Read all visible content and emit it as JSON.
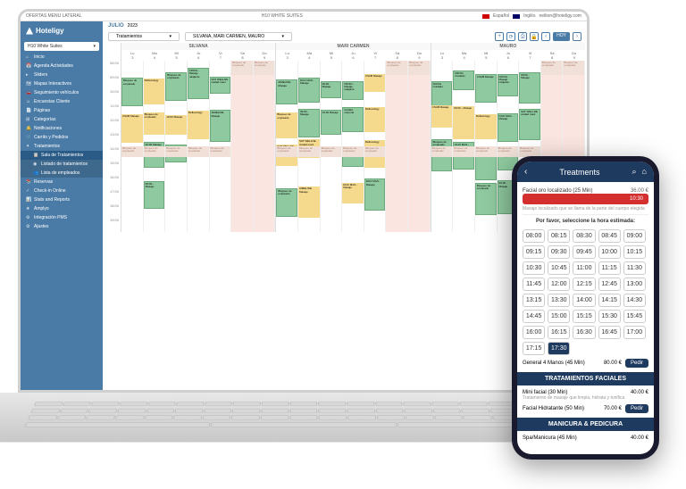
{
  "brand": "Hoteligy",
  "topbar": {
    "breadcrumb": "OFERTAS MENU LATERAL",
    "hotel_name": "H10 WHITE SUITES",
    "lang1": "Español",
    "lang2": "Inglés",
    "email": "neliton@hoteligy.com"
  },
  "sidebar": {
    "hotel": "H10 White Suites",
    "items": [
      {
        "icon": "⌂",
        "label": "Inicio"
      },
      {
        "icon": "📅",
        "label": "Agenda Actividades"
      },
      {
        "icon": "▸",
        "label": "Sliders"
      },
      {
        "icon": "🗺",
        "label": "Mapas Interactivos"
      },
      {
        "icon": "🚗",
        "label": "Seguimiento vehículos"
      },
      {
        "icon": "☺",
        "label": "Encuestas Cliente"
      },
      {
        "icon": "📄",
        "label": "Páginas"
      },
      {
        "icon": "⊞",
        "label": "Categorías"
      },
      {
        "icon": "🔔",
        "label": "Notificaciones"
      },
      {
        "icon": "🛒",
        "label": "Carrito y Pedidos"
      },
      {
        "icon": "✦",
        "label": "Tratamientos"
      },
      {
        "icon": "📋",
        "label": "Sala de Tratamientos",
        "sub": true,
        "active": true
      },
      {
        "icon": "◉",
        "label": "Listado de tratamientos",
        "sub": true
      },
      {
        "icon": "👥",
        "label": "Lista de empleados",
        "sub": true
      },
      {
        "icon": "📚",
        "label": "Reservas"
      },
      {
        "icon": "✓",
        "label": "Check-in Online"
      },
      {
        "icon": "📊",
        "label": "Stats and Reports"
      },
      {
        "icon": "★",
        "label": "Amplyo"
      },
      {
        "icon": "⚙",
        "label": "Integración PMS"
      },
      {
        "icon": "⚙",
        "label": "Ajustes"
      }
    ]
  },
  "calendar": {
    "month": "JULIO",
    "year": "2023",
    "filter1": "Tratamientos",
    "filter2": "SILVANA, MARI CARMEN, MAURO",
    "today_btn": "HOY",
    "staff": [
      "SILVANA",
      "MARI CARMEN",
      "MAURO"
    ],
    "days": [
      {
        "d": "Lu",
        "n": "3"
      },
      {
        "d": "Ma",
        "n": "4"
      },
      {
        "d": "Mi",
        "n": "5"
      },
      {
        "d": "Ju",
        "n": "6"
      },
      {
        "d": "Vi",
        "n": "7"
      },
      {
        "d": "Sá",
        "n": "8"
      },
      {
        "d": "Do",
        "n": "9"
      }
    ],
    "hours": [
      "08:00",
      "09:00",
      "10:00",
      "11:00",
      "12:00",
      "13:00",
      "14:00",
      "15:00",
      "16:00",
      "17:00",
      "18:00",
      "19:00"
    ]
  },
  "phone": {
    "title": "Treatments",
    "service1": "Facial oro localizado (25 Min)",
    "service1_price": "36.00 €",
    "red_time": "10:30",
    "service1_note": "Masaje localizado que se llama de la parte del cuerpo elegida",
    "instruction": "Por favor, seleccione la hora estimada:",
    "times": [
      "08:00",
      "08:15",
      "08:30",
      "08:45",
      "09:00",
      "09:15",
      "09:30",
      "09:45",
      "10:00",
      "10:15",
      "10:30",
      "10:45",
      "11:00",
      "11:15",
      "11:30",
      "11:45",
      "12:00",
      "12:15",
      "12:45",
      "13:00",
      "13:15",
      "13:30",
      "14:00",
      "14:15",
      "14:30",
      "14:45",
      "15:00",
      "15:15",
      "15:30",
      "15:45",
      "16:00",
      "16:15",
      "16:30",
      "16:45",
      "17:00",
      "17:15"
    ],
    "selected_time": "17:30",
    "general": "General 4 Manos (45 Min)",
    "general_price": "80.00 €",
    "add": "Pedir",
    "section1": "TRATAMIENTOS FACIALES",
    "facial1": "Mini facial (30 Min)",
    "facial1_price": "40.00 €",
    "facial1_desc": "Tratamiento de masaje que limpia, hidrata y tonifica",
    "facial2": "Facial Hidratante (50 Min)",
    "facial2_price": "70.00 €",
    "section2": "MANICURA & PEDICURA",
    "mani1": "Spa/Manicura (45 Min)",
    "mani1_price": "40.00 €"
  }
}
